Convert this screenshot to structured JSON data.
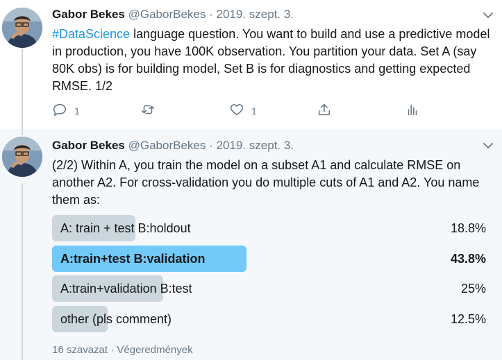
{
  "tweet1": {
    "author_name": "Gabor Bekes",
    "author_handle": "@GaborBekes",
    "separator": "·",
    "date": "2019. szept. 3.",
    "hashtag": "#DataScience",
    "text_rest": " language question. You want to build and use a predictive model in production, you have 100K observation. You partition your data. Set A (say 80K obs) is for building model, Set B is for diagnostics and getting expected RMSE. 1/2",
    "reply_count": "1",
    "like_count": "1"
  },
  "tweet2": {
    "author_name": "Gabor Bekes",
    "author_handle": "@GaborBekes",
    "separator": "·",
    "date": "2019. szept. 3.",
    "text": "(2/2) Within A, you train the model on a subset A1 and calculate RMSE on another A2. For cross-validation you do multiple cuts of A1 and A2. You name them as:",
    "poll": {
      "options": [
        {
          "label": "A: train  + test B:holdout",
          "percent": "18.8%",
          "share": 0.188,
          "winner": false
        },
        {
          "label": "A:train+test B:validation",
          "percent": "43.8%",
          "share": 0.438,
          "winner": true
        },
        {
          "label": "A:train+validation B:test",
          "percent": "25%",
          "share": 0.25,
          "winner": false
        },
        {
          "label": "other (pls comment)",
          "percent": "12.5%",
          "share": 0.125,
          "winner": false
        }
      ],
      "votes": "16 szavazat",
      "separator": "·",
      "status": "Végeredmények"
    }
  },
  "colors": {
    "accent": "#1b95e0",
    "winner_bar": "#71c9f8",
    "bar": "#ccd6dd",
    "muted": "#657786"
  }
}
